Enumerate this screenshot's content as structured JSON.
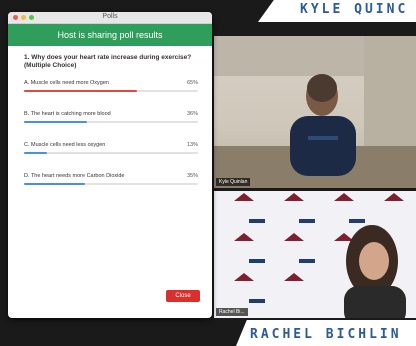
{
  "broadcast": {
    "top_name": "KYLE QUINC",
    "bottom_name": "RACHEL BICHLIN"
  },
  "poll_window": {
    "title": "Polls",
    "banner": "Host is sharing poll results",
    "question": "1. Why does your heart rate increase during exercise?(Multiple Choice)",
    "options": [
      {
        "label": "A. Muscle cells need more Oxygen",
        "pct": "65%",
        "fraction": 0.65
      },
      {
        "label": "B. The heart is catching more blood",
        "pct": "36%",
        "fraction": 0.36
      },
      {
        "label": "C. Muscle cells need less oxygen",
        "pct": "13%",
        "fraction": 0.13
      },
      {
        "label": "D. The heart needs more Carbon Dioxide",
        "pct": "35%",
        "fraction": 0.35
      }
    ],
    "close_label": "Close"
  },
  "video_tiles": {
    "top_participant": "Kyle Quinlan",
    "bottom_participant": "Rachel Bi..."
  },
  "colors": {
    "banner_green": "#2f9e5b",
    "bar_red": "#e5483f",
    "bar_blue": "#4a90e2",
    "close_red": "#d9302e",
    "brand_blue": "#2d5b9a"
  }
}
